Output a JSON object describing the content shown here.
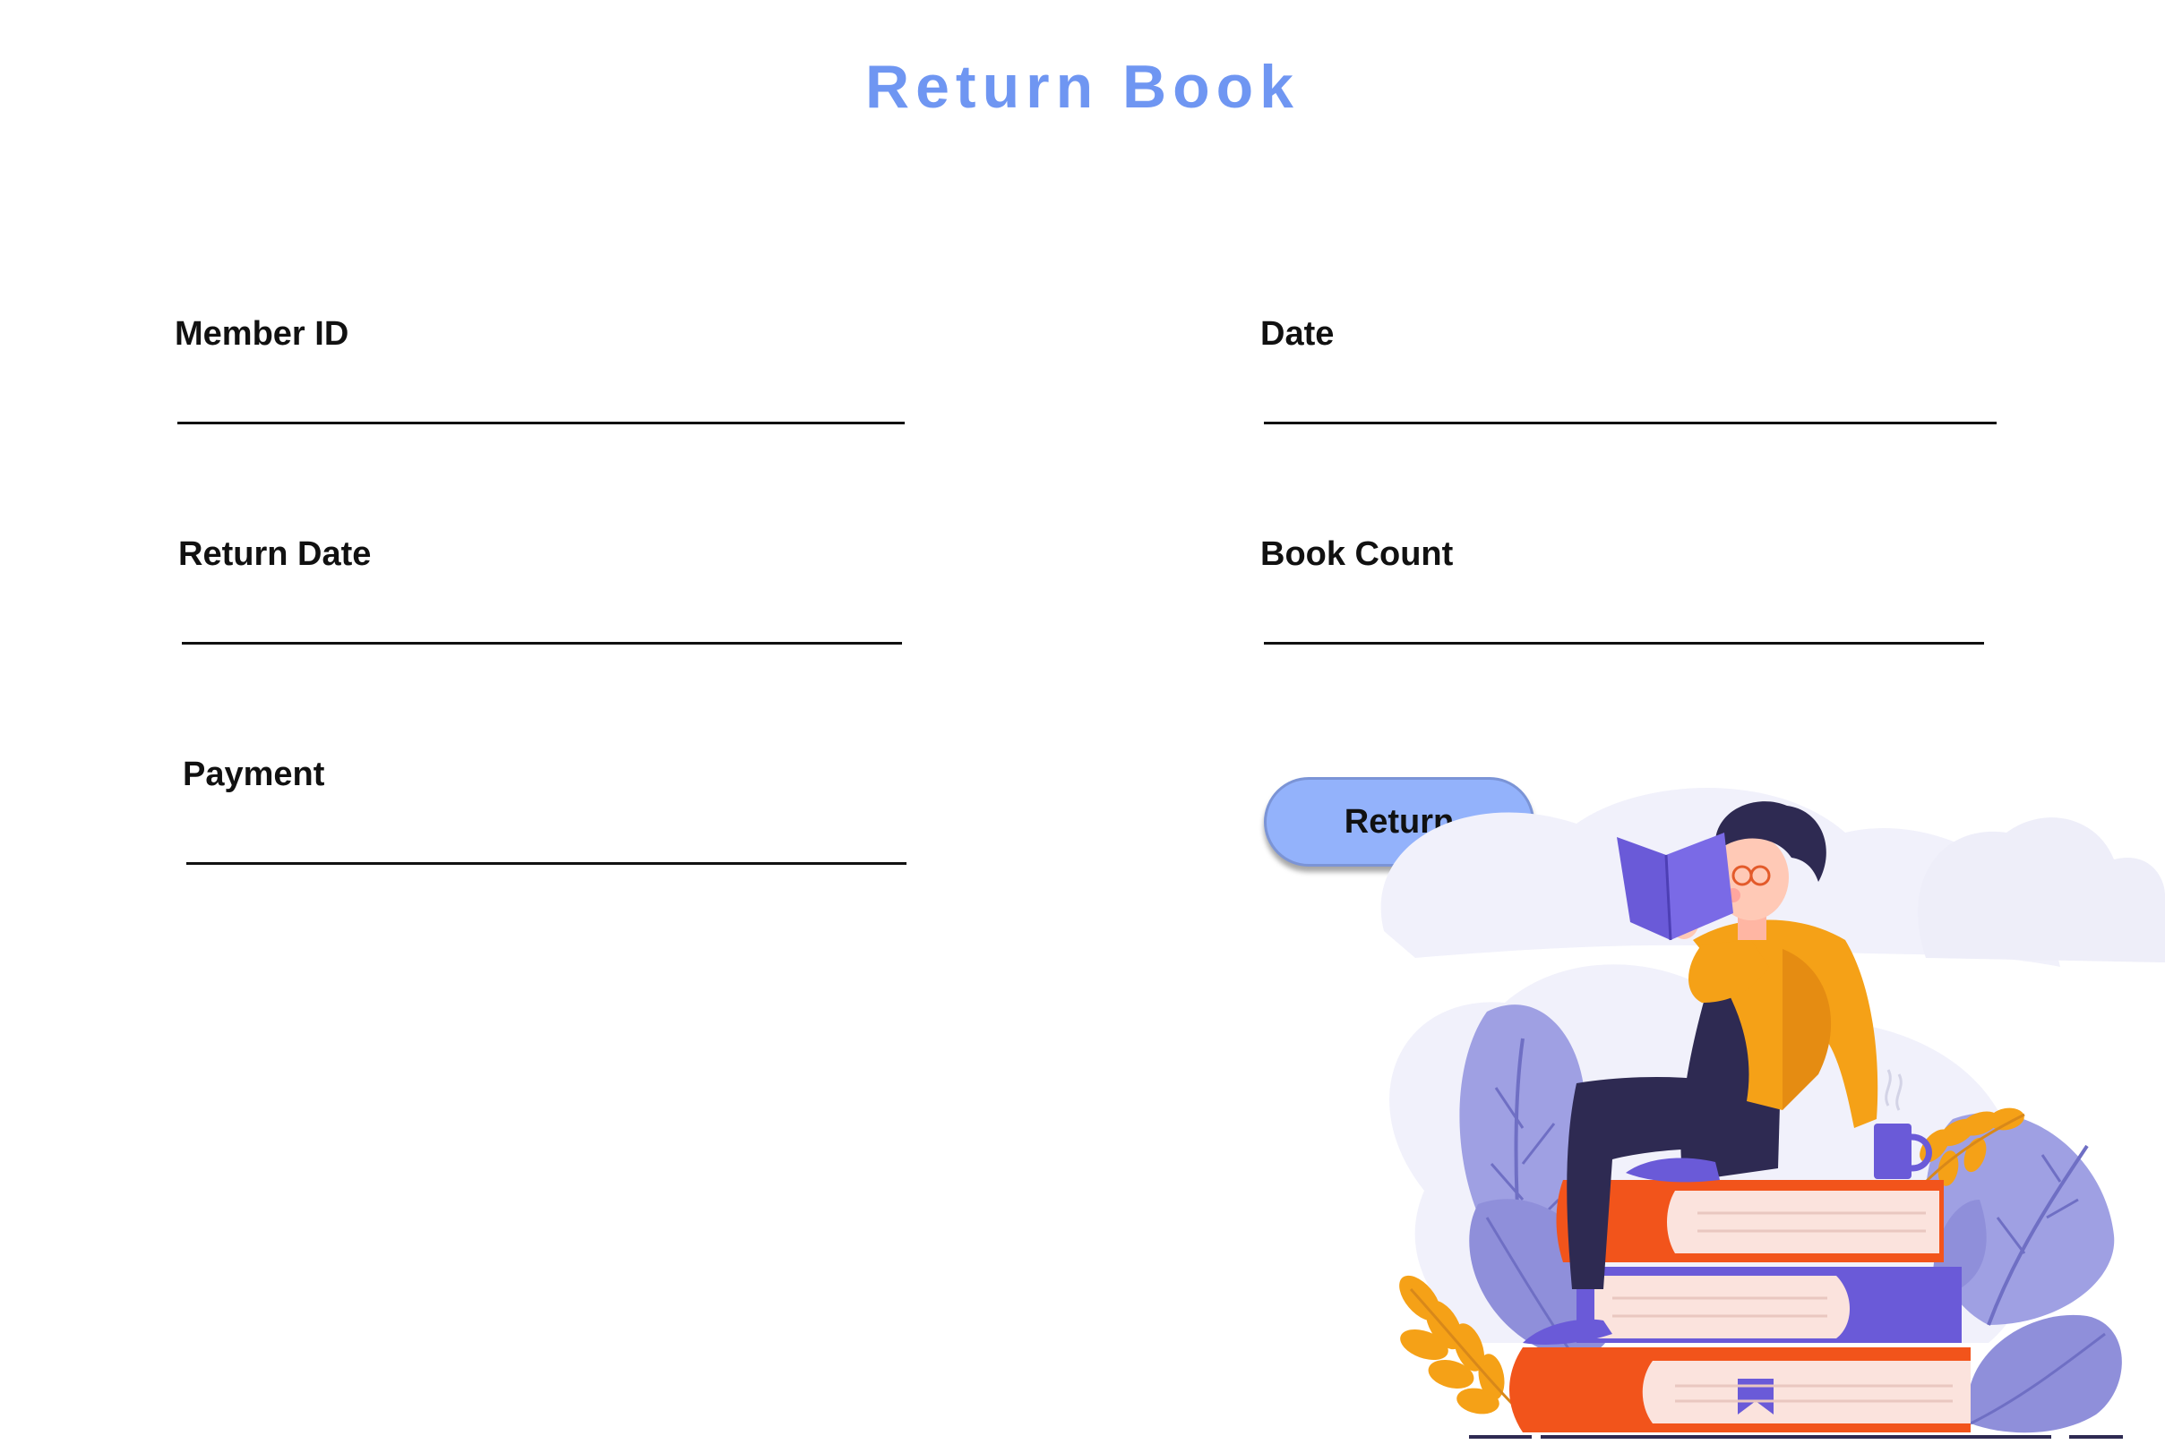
{
  "page": {
    "title": "Return Book"
  },
  "form": {
    "member_id": {
      "label": "Member ID",
      "value": ""
    },
    "date": {
      "label": "Date",
      "value": ""
    },
    "return_date": {
      "label": "Return Date",
      "value": ""
    },
    "book_count": {
      "label": "Book Count",
      "value": ""
    },
    "payment": {
      "label": "Payment",
      "value": ""
    }
  },
  "actions": {
    "return_label": "Return"
  },
  "illustration": {
    "icon": "person-reading-on-books-illustration"
  },
  "colors": {
    "title": "#6f96f2",
    "button": "#93b2fb",
    "orange": "#f5a117",
    "red_book": "#f2541b",
    "purple": "#6a5ad8",
    "lavender": "#9fa0e3",
    "navy": "#2e2a52"
  }
}
